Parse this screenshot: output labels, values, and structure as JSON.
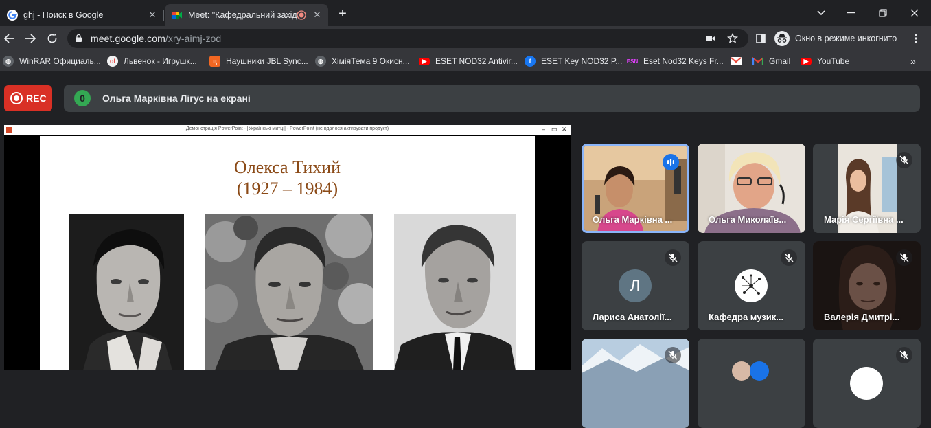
{
  "tabs": [
    {
      "title": "ghj - Поиск в Google",
      "favicon": "google-icon"
    },
    {
      "title": "Meet: \"Кафедральний захід",
      "favicon": "meet-icon",
      "recording_dot": "recording-dot-icon"
    }
  ],
  "toolbar": {
    "url_host": "meet.google.com",
    "url_path": "/xry-aimj-zod",
    "incognito_label": "Окно в режиме инкогнито"
  },
  "bookmarks": [
    {
      "label": "WinRAR Официаль...",
      "icon": "globe-icon",
      "color": "#5f6368"
    },
    {
      "label": "Львенок - Игрушк...",
      "icon": "lvenok-icon",
      "color": "#f2f2f2"
    },
    {
      "label": "Наушники JBL Sync...",
      "icon": "shop-icon",
      "color": "#f26722"
    },
    {
      "label": "ХіміяТема 9 Окисн...",
      "icon": "globe-icon",
      "color": "#5f6368"
    },
    {
      "label": "ESET NOD32 Antivir...",
      "icon": "youtube-icon",
      "color": "#ff0000"
    },
    {
      "label": "ESET Key NOD32 P...",
      "icon": "facebook-icon",
      "color": "#1877f2"
    },
    {
      "label": "Eset Nod32 Keys Fr...",
      "icon": "esn-icon",
      "color": "#c2185b"
    },
    {
      "label": "",
      "icon": "gmail-icon",
      "color": "#ea4335"
    },
    {
      "label": "Gmail",
      "icon": "gmail-icon",
      "color": "#ea4335"
    },
    {
      "label": "YouTube",
      "icon": "youtube-icon",
      "color": "#ff0000"
    }
  ],
  "meet": {
    "rec_label": "REC",
    "presenter_count": "0",
    "presenter_text": "Ольга Марківна Лігус на екрані"
  },
  "slide": {
    "window_title": "Демонстрація PowerPoint - [Українські митці] - PowerPoint (не вдалося активувати продукт)",
    "title_line1": "Олекса Тихий",
    "title_line2": "(1927 – 1984)"
  },
  "participants": [
    {
      "name": "Ольга Марківна ...",
      "speaking": true
    },
    {
      "name": "Ольга Миколаїв...",
      "muted": false
    },
    {
      "name": "Марія Сергіївна ...",
      "muted": true
    },
    {
      "name": "Лариса Анатолії...",
      "muted": true,
      "initial": "Л",
      "avatar_color": "#5f7583"
    },
    {
      "name": "Кафедра музик...",
      "muted": true
    },
    {
      "name": "Валерія Дмитрі...",
      "muted": true
    },
    {
      "name": "",
      "muted": true
    },
    {
      "name": "",
      "muted": false
    },
    {
      "name": "",
      "muted": true
    }
  ],
  "colors": {
    "accent_blue": "#8ab4f8",
    "rec_red": "#d93025",
    "tile_bg": "#3c4043",
    "title_brown": "#8b4a17"
  }
}
